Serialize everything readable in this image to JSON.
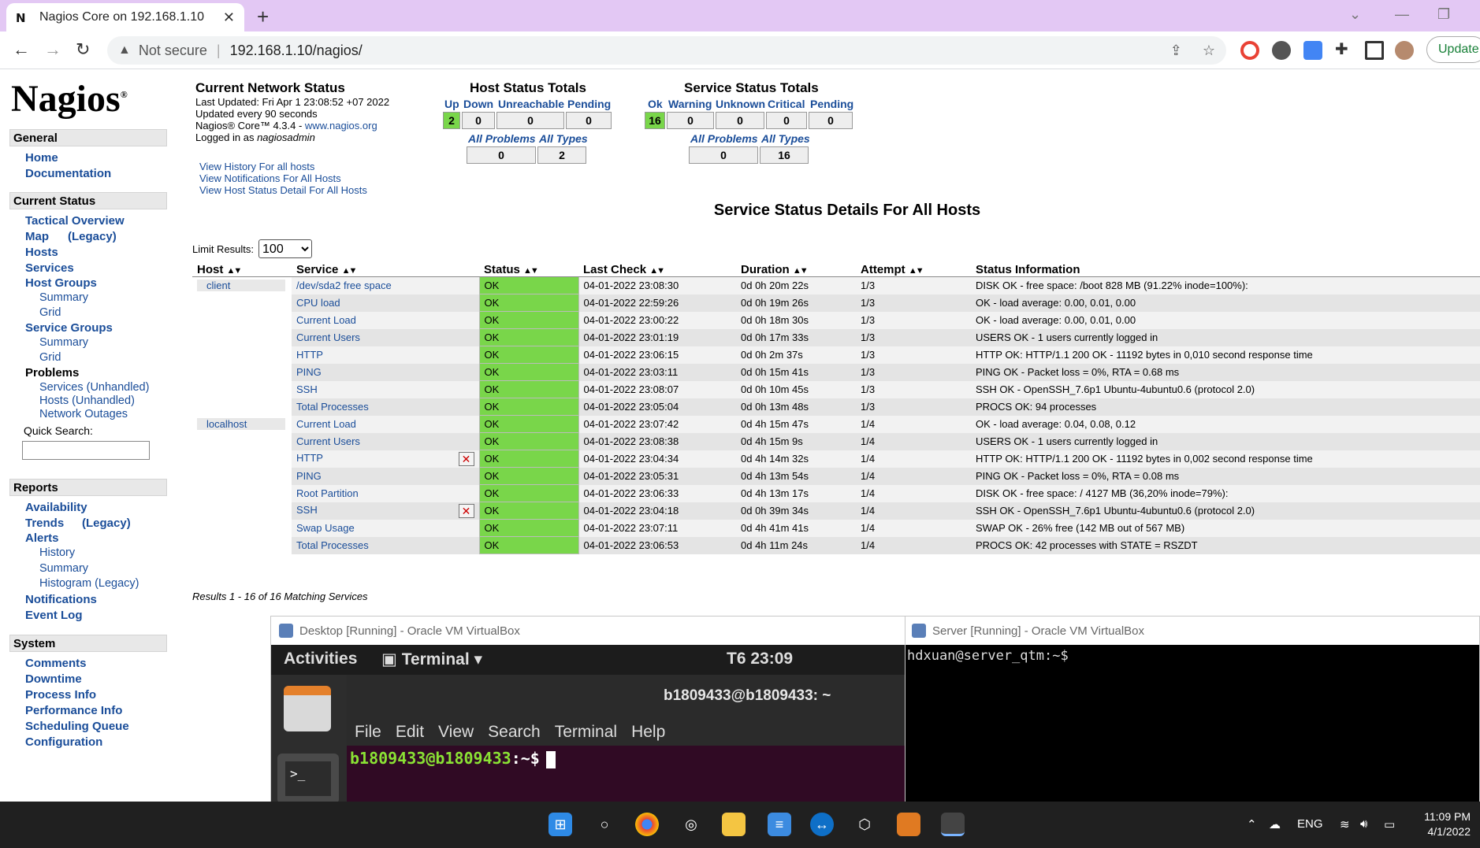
{
  "browser": {
    "tab_title": "Nagios Core on 192.168.1.10",
    "new_tab_icon": "plus-icon",
    "security_label": "Not secure",
    "url": "192.168.1.10/nagios/",
    "update_label": "Update"
  },
  "sidebar": {
    "logo": "Nagios",
    "general": {
      "title": "General",
      "items": [
        "Home",
        "Documentation"
      ]
    },
    "current_status": {
      "title": "Current Status",
      "tactical": "Tactical Overview",
      "map": "Map",
      "map_legacy": "(Legacy)",
      "hosts": "Hosts",
      "services": "Services",
      "host_groups": "Host Groups",
      "hg_summary": "Summary",
      "hg_grid": "Grid",
      "service_groups": "Service Groups",
      "sg_summary": "Summary",
      "sg_grid": "Grid",
      "problems": "Problems",
      "services_unhandled": "Services (Unhandled)",
      "hosts_unhandled": "Hosts (Unhandled)",
      "network_outages": "Network Outages",
      "quick_search": "Quick Search:"
    },
    "reports": {
      "title": "Reports",
      "availability": "Availability",
      "trends": "Trends",
      "trends_legacy": "(Legacy)",
      "alerts": "Alerts",
      "history": "History",
      "summary": "Summary",
      "histogram": "Histogram (Legacy)",
      "notifications": "Notifications",
      "event_log": "Event Log"
    },
    "system": {
      "title": "System",
      "items": [
        "Comments",
        "Downtime",
        "Process Info",
        "Performance Info",
        "Scheduling Queue",
        "Configuration"
      ]
    }
  },
  "status": {
    "title": "Current Network Status",
    "last_updated": "Last Updated: Fri Apr 1 23:08:52 +07 2022",
    "update_interval": "Updated every 90 seconds",
    "version_prefix": "Nagios® Core™ 4.3.4 - ",
    "version_link": "www.nagios.org",
    "logged_in_prefix": "Logged in as ",
    "logged_in_user": "nagiosadmin",
    "links": [
      "View History For all hosts",
      "View Notifications For All Hosts",
      "View Host Status Detail For All Hosts"
    ]
  },
  "host_totals": {
    "title": "Host Status Totals",
    "headers": [
      "Up",
      "Down",
      "Unreachable",
      "Pending"
    ],
    "values": [
      "2",
      "0",
      "0",
      "0"
    ],
    "all_problems_label": "All Problems",
    "all_types_label": "All Types",
    "all_problems": "0",
    "all_types": "2"
  },
  "service_totals": {
    "title": "Service Status Totals",
    "headers": [
      "Ok",
      "Warning",
      "Unknown",
      "Critical",
      "Pending"
    ],
    "values": [
      "16",
      "0",
      "0",
      "0",
      "0"
    ],
    "all_problems_label": "All Problems",
    "all_types_label": "All Types",
    "all_problems": "0",
    "all_types": "16"
  },
  "details": {
    "title": "Service Status Details For All Hosts",
    "limit_label": "Limit Results:",
    "limit_value": "100",
    "columns": [
      "Host",
      "Service",
      "Status",
      "Last Check",
      "Duration",
      "Attempt",
      "Status Information"
    ],
    "rows": [
      {
        "host": "client",
        "service": "/dev/sda2 free space",
        "status": "OK",
        "last_check": "04-01-2022 23:08:30",
        "duration": "0d 0h 20m 22s",
        "attempt": "1/3",
        "info": "DISK OK - free space: /boot 828 MB (91.22% inode=100%):"
      },
      {
        "host": "",
        "service": "CPU load",
        "status": "OK",
        "last_check": "04-01-2022 22:59:26",
        "duration": "0d 0h 19m 26s",
        "attempt": "1/3",
        "info": "OK - load average: 0.00, 0.01, 0.00"
      },
      {
        "host": "",
        "service": "Current Load",
        "status": "OK",
        "last_check": "04-01-2022 23:00:22",
        "duration": "0d 0h 18m 30s",
        "attempt": "1/3",
        "info": "OK - load average: 0.00, 0.01, 0.00"
      },
      {
        "host": "",
        "service": "Current Users",
        "status": "OK",
        "last_check": "04-01-2022 23:01:19",
        "duration": "0d 0h 17m 33s",
        "attempt": "1/3",
        "info": "USERS OK - 1 users currently logged in"
      },
      {
        "host": "",
        "service": "HTTP",
        "status": "OK",
        "last_check": "04-01-2022 23:06:15",
        "duration": "0d 0h 2m 37s",
        "attempt": "1/3",
        "info": "HTTP OK: HTTP/1.1 200 OK - 11192 bytes in 0,010 second response time"
      },
      {
        "host": "",
        "service": "PING",
        "status": "OK",
        "last_check": "04-01-2022 23:03:11",
        "duration": "0d 0h 15m 41s",
        "attempt": "1/3",
        "info": "PING OK - Packet loss = 0%, RTA = 0.68 ms"
      },
      {
        "host": "",
        "service": "SSH",
        "status": "OK",
        "last_check": "04-01-2022 23:08:07",
        "duration": "0d 0h 10m 45s",
        "attempt": "1/3",
        "info": "SSH OK - OpenSSH_7.6p1 Ubuntu-4ubuntu0.6 (protocol 2.0)"
      },
      {
        "host": "",
        "service": "Total Processes",
        "status": "OK",
        "last_check": "04-01-2022 23:05:04",
        "duration": "0d 0h 13m 48s",
        "attempt": "1/3",
        "info": "PROCS OK: 94 processes"
      },
      {
        "host": "localhost",
        "service": "Current Load",
        "status": "OK",
        "last_check": "04-01-2022 23:07:42",
        "duration": "0d 4h 15m 47s",
        "attempt": "1/4",
        "info": "OK - load average: 0.04, 0.08, 0.12"
      },
      {
        "host": "",
        "service": "Current Users",
        "status": "OK",
        "last_check": "04-01-2022 23:08:38",
        "duration": "0d 4h 15m 9s",
        "attempt": "1/4",
        "info": "USERS OK - 1 users currently logged in"
      },
      {
        "host": "",
        "service": "HTTP",
        "status": "OK",
        "last_check": "04-01-2022 23:04:34",
        "duration": "0d 4h 14m 32s",
        "attempt": "1/4",
        "info": "HTTP OK: HTTP/1.1 200 OK - 11192 bytes in 0,002 second response time",
        "icon": "notifications-disabled-icon"
      },
      {
        "host": "",
        "service": "PING",
        "status": "OK",
        "last_check": "04-01-2022 23:05:31",
        "duration": "0d 4h 13m 54s",
        "attempt": "1/4",
        "info": "PING OK - Packet loss = 0%, RTA = 0.08 ms"
      },
      {
        "host": "",
        "service": "Root Partition",
        "status": "OK",
        "last_check": "04-01-2022 23:06:33",
        "duration": "0d 4h 13m 17s",
        "attempt": "1/4",
        "info": "DISK OK - free space: / 4127 MB (36,20% inode=79%):"
      },
      {
        "host": "",
        "service": "SSH",
        "status": "OK",
        "last_check": "04-01-2022 23:04:18",
        "duration": "0d 0h 39m 34s",
        "attempt": "1/4",
        "info": "SSH OK - OpenSSH_7.6p1 Ubuntu-4ubuntu0.6 (protocol 2.0)",
        "icon": "notifications-disabled-icon"
      },
      {
        "host": "",
        "service": "Swap Usage",
        "status": "OK",
        "last_check": "04-01-2022 23:07:11",
        "duration": "0d 4h 41m 41s",
        "attempt": "1/4",
        "info": "SWAP OK - 26% free (142 MB out of 567 MB)"
      },
      {
        "host": "",
        "service": "Total Processes",
        "status": "OK",
        "last_check": "04-01-2022 23:06:53",
        "duration": "0d 4h 11m 24s",
        "attempt": "1/4",
        "info": "PROCS OK: 42 processes with STATE = RSZDT"
      }
    ],
    "results_text": "Results 1 - 16 of 16 Matching Services"
  },
  "vbox_desktop": {
    "title": "Desktop [Running] - Oracle VM VirtualBox",
    "activities": "Activities",
    "terminal_app": "Terminal",
    "clock": "T6 23:09",
    "term_title": "b1809433@b1809433: ~",
    "menu": [
      "File",
      "Edit",
      "View",
      "Search",
      "Terminal",
      "Help"
    ],
    "prompt_user": "b1809433@b1809433",
    "prompt_tail": ":~$"
  },
  "vbox_server": {
    "title": "Server [Running] - Oracle VM VirtualBox",
    "prompt": "hdxuan@server_qtm:~$"
  },
  "taskbar": {
    "lang": "ENG",
    "time": "11:09 PM",
    "date": "4/1/2022"
  },
  "colors": {
    "ok_green": "#79d64a",
    "link_blue": "#1a4d99",
    "tab_bar": "#e3c8f4",
    "terminal_bg": "#300a24"
  }
}
